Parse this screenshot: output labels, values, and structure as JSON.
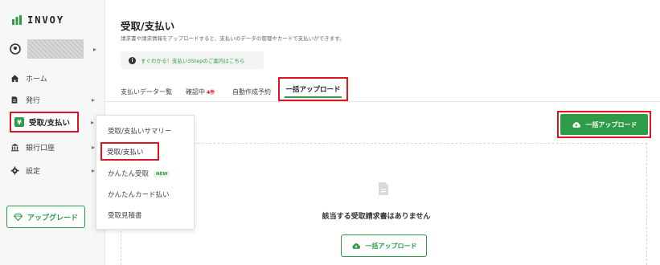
{
  "app": {
    "logo_text": "INVOY"
  },
  "sidebar": {
    "items": [
      {
        "label": "ホーム",
        "icon": "home-icon"
      },
      {
        "label": "発行",
        "icon": "document-icon"
      },
      {
        "label": "受取/支払い",
        "icon": "receive-pay-icon"
      },
      {
        "label": "銀行口座",
        "icon": "bank-icon"
      },
      {
        "label": "設定",
        "icon": "gear-icon"
      }
    ],
    "upgrade_label": "アップグレード"
  },
  "submenu": {
    "items": [
      {
        "label": "受取/支払いサマリー"
      },
      {
        "label": "受取/支払い"
      },
      {
        "label": "かんたん受取",
        "badge": "NEW"
      },
      {
        "label": "かんたんカード払い"
      },
      {
        "label": "受取見積書"
      }
    ]
  },
  "header": {
    "title": "受取/支払い",
    "subtitle": "請求書や請求情報をアップロードすると、支払いのデータの管理やカードで支払いができます。",
    "guide_link": "すぐわかる！支払い3Stepのご案内はこちら"
  },
  "tabs": [
    {
      "label": "支払いデータ一覧"
    },
    {
      "label": "確認中",
      "badge": "4件"
    },
    {
      "label": "自動作成予約"
    },
    {
      "label": "一括アップロード"
    }
  ],
  "actions": {
    "bulk_upload_label": "一括アップロード"
  },
  "empty_state": {
    "message": "該当する受取請求書はありません",
    "button_label": "一括アップロード"
  },
  "colors": {
    "brand_green": "#2e9b47",
    "highlight_red": "#e0141e"
  }
}
